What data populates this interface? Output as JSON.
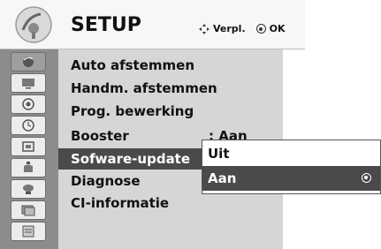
{
  "header": {
    "title": "SETUP",
    "hint_move": "Verpl.",
    "hint_ok": "OK"
  },
  "sidebar": {
    "icons": [
      "picture-menu-icon",
      "tv-screen-icon",
      "speaker-icon",
      "clock-icon",
      "lock-icon",
      "option-icon",
      "input-icon",
      "usb-photo-icon",
      "guide-icon"
    ]
  },
  "menu": {
    "items": [
      {
        "label": "Auto afstemmen"
      },
      {
        "label": "Handm. afstemmen"
      },
      {
        "label": "Prog. bewerking"
      },
      {
        "label": "Booster",
        "value": ": Aan"
      },
      {
        "label": "Sofware-update"
      },
      {
        "label": "Diagnose"
      },
      {
        "label": "CI-informatie"
      }
    ]
  },
  "popup": {
    "options": [
      {
        "label": "Uit"
      },
      {
        "label": "Aan"
      }
    ]
  }
}
